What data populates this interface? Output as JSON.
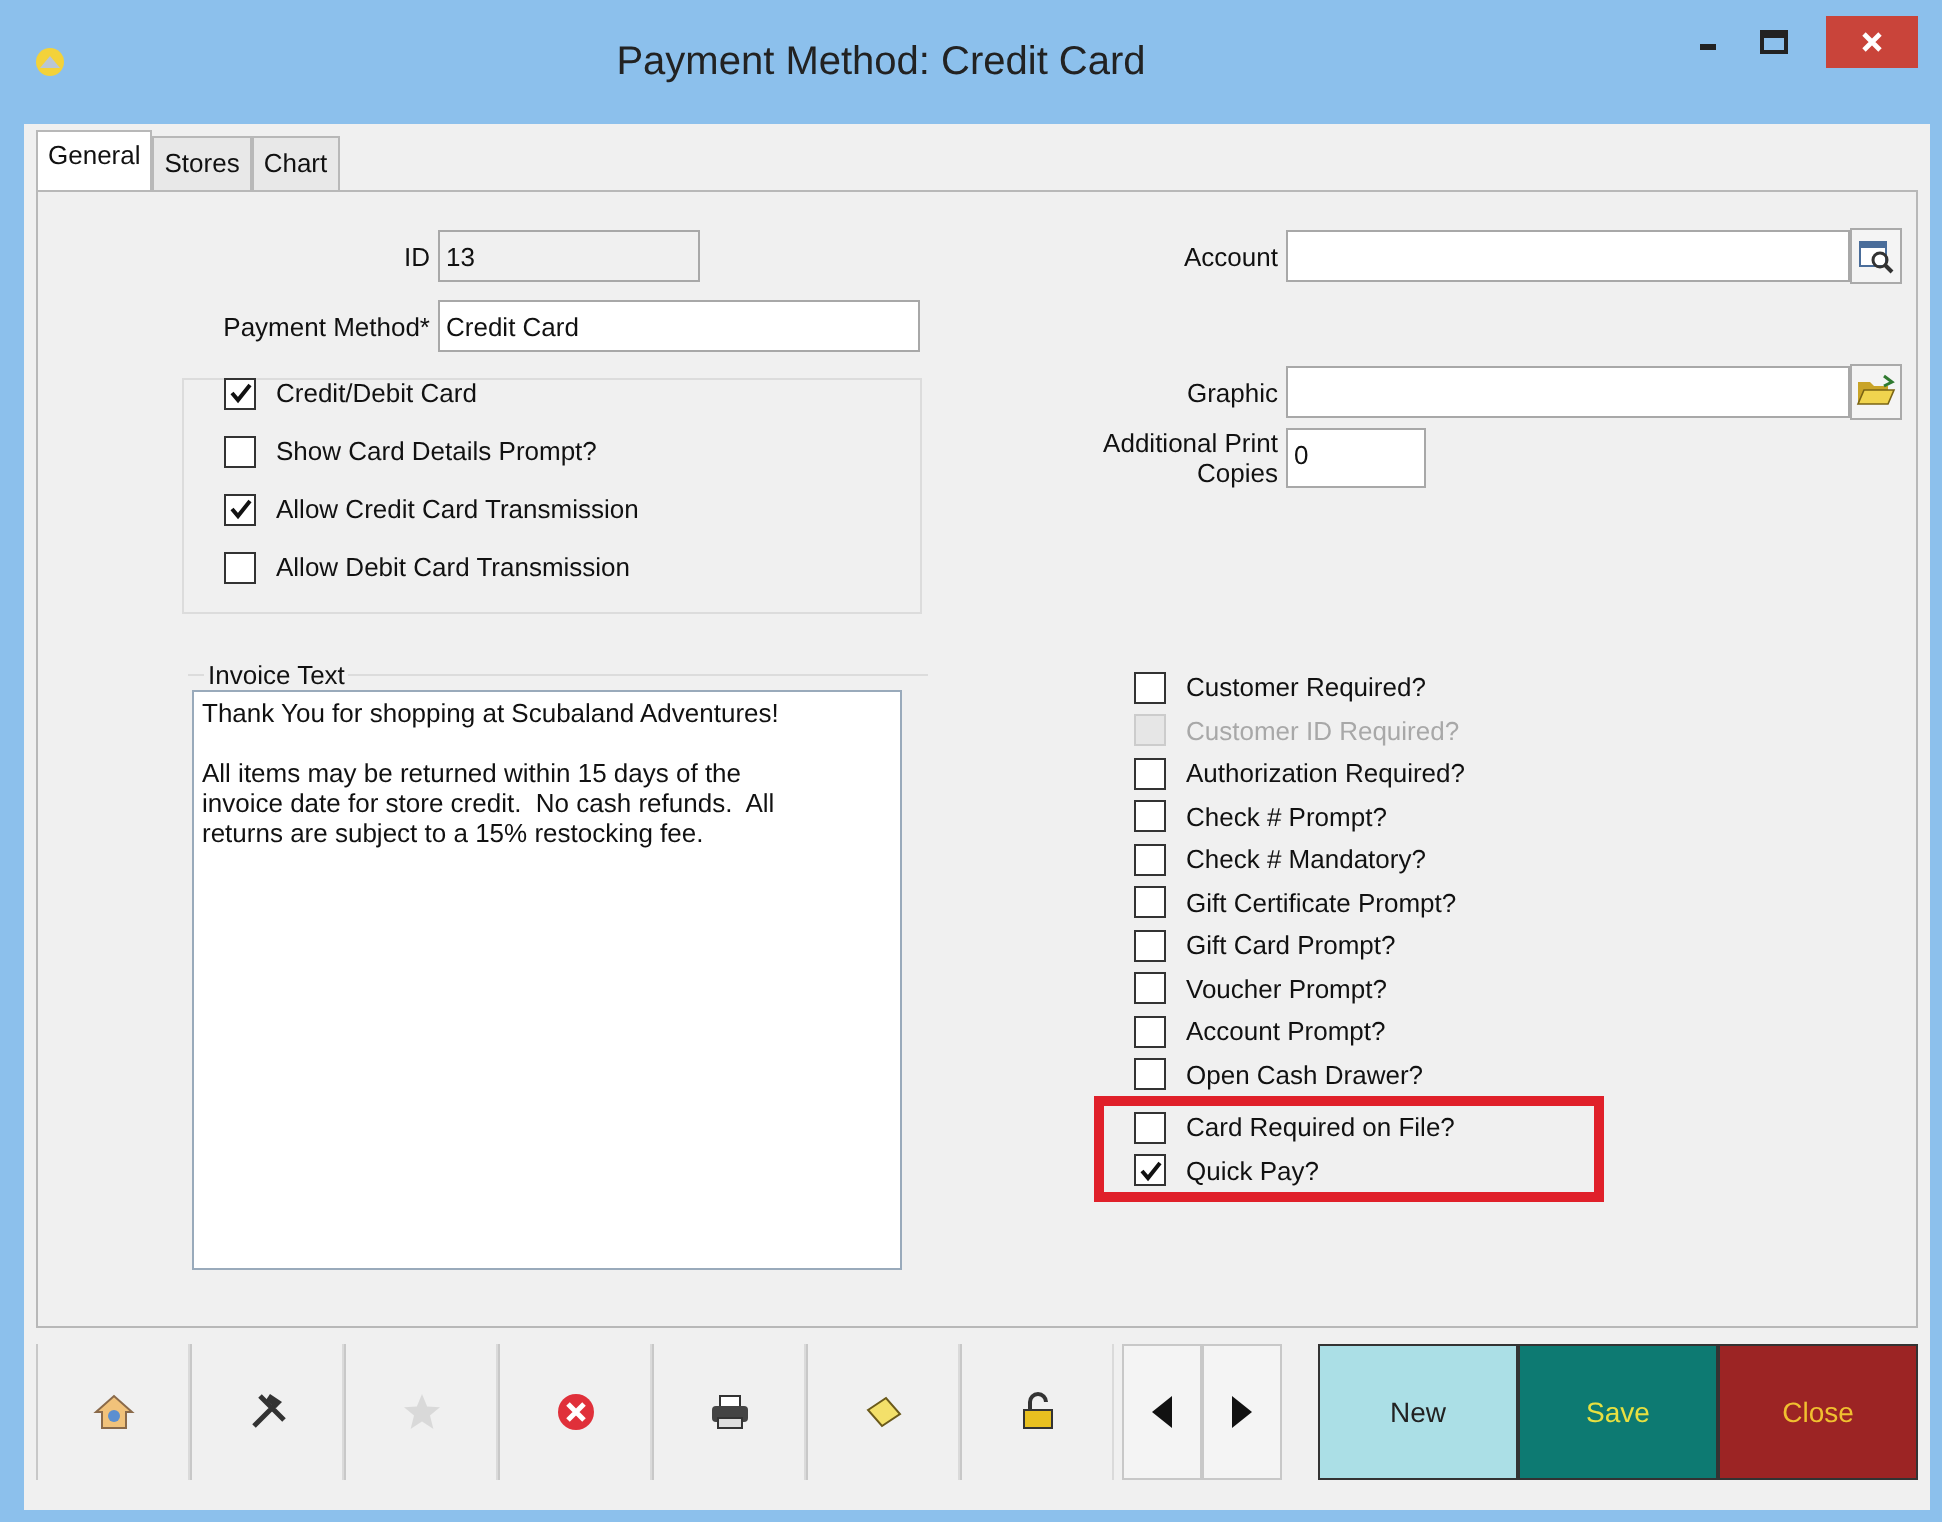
{
  "window": {
    "title": "Payment Method: Credit Card"
  },
  "tabs": [
    {
      "label": "General",
      "selected": true
    },
    {
      "label": "Stores",
      "selected": false
    },
    {
      "label": "Chart",
      "selected": false
    }
  ],
  "form": {
    "id": {
      "label": "ID",
      "value": "13",
      "disabled": true
    },
    "payment_method": {
      "label": "Payment Method*",
      "value": "Credit Card",
      "disabled": false
    },
    "card_group": [
      {
        "label": "Credit/Debit Card",
        "checked": true
      },
      {
        "label": "Show Card Details Prompt?",
        "checked": false
      },
      {
        "label": "Allow Credit Card Transmission",
        "checked": true
      },
      {
        "label": "Allow Debit Card Transmission",
        "checked": false
      }
    ],
    "invoice_text": {
      "label": "Invoice Text",
      "value": "Thank You for shopping at Scubaland Adventures!\n\nAll items may be returned within 15 days of the invoice date for store credit.  No cash refunds.  All returns are subject to a 15% restocking fee."
    },
    "account": {
      "label": "Account"
    },
    "graphic": {
      "label": "Graphic"
    },
    "print_copies": {
      "label": "Additional Print Copies",
      "value": "0"
    },
    "options": [
      {
        "label": "Customer Required?",
        "checked": false,
        "disabled": false,
        "highlighted": false
      },
      {
        "label": "Customer ID Required?",
        "checked": false,
        "disabled": true,
        "highlighted": false
      },
      {
        "label": "Authorization Required?",
        "checked": false,
        "disabled": false,
        "highlighted": false
      },
      {
        "label": "Check # Prompt?",
        "checked": false,
        "disabled": false,
        "highlighted": false
      },
      {
        "label": "Check # Mandatory?",
        "checked": false,
        "disabled": false,
        "highlighted": false
      },
      {
        "label": "Gift Certificate Prompt?",
        "checked": false,
        "disabled": false,
        "highlighted": false
      },
      {
        "label": "Gift Card Prompt?",
        "checked": false,
        "disabled": false,
        "highlighted": false
      },
      {
        "label": "Voucher Prompt?",
        "checked": false,
        "disabled": false,
        "highlighted": false
      },
      {
        "label": "Account Prompt?",
        "checked": false,
        "disabled": false,
        "highlighted": false
      },
      {
        "label": "Open Cash Drawer?",
        "checked": false,
        "disabled": false,
        "highlighted": false
      },
      {
        "label": "Card Required on File?",
        "checked": false,
        "disabled": false,
        "highlighted": true
      },
      {
        "label": "Quick Pay?",
        "checked": true,
        "disabled": false,
        "highlighted": true
      }
    ]
  },
  "toolbar": {
    "tools": [
      {
        "kind": "home",
        "disabled": false
      },
      {
        "kind": "tools",
        "disabled": false
      },
      {
        "kind": "star",
        "disabled": true
      },
      {
        "kind": "delete",
        "disabled": false
      },
      {
        "kind": "print",
        "disabled": false
      },
      {
        "kind": "note",
        "disabled": false
      },
      {
        "kind": "lock",
        "disabled": false
      }
    ],
    "nav": [
      {
        "kind": "prev"
      },
      {
        "kind": "next"
      }
    ],
    "actions": [
      {
        "label": "New",
        "kind": "new"
      },
      {
        "label": "Save",
        "kind": "save"
      },
      {
        "label": "Close",
        "kind": "close"
      }
    ]
  }
}
